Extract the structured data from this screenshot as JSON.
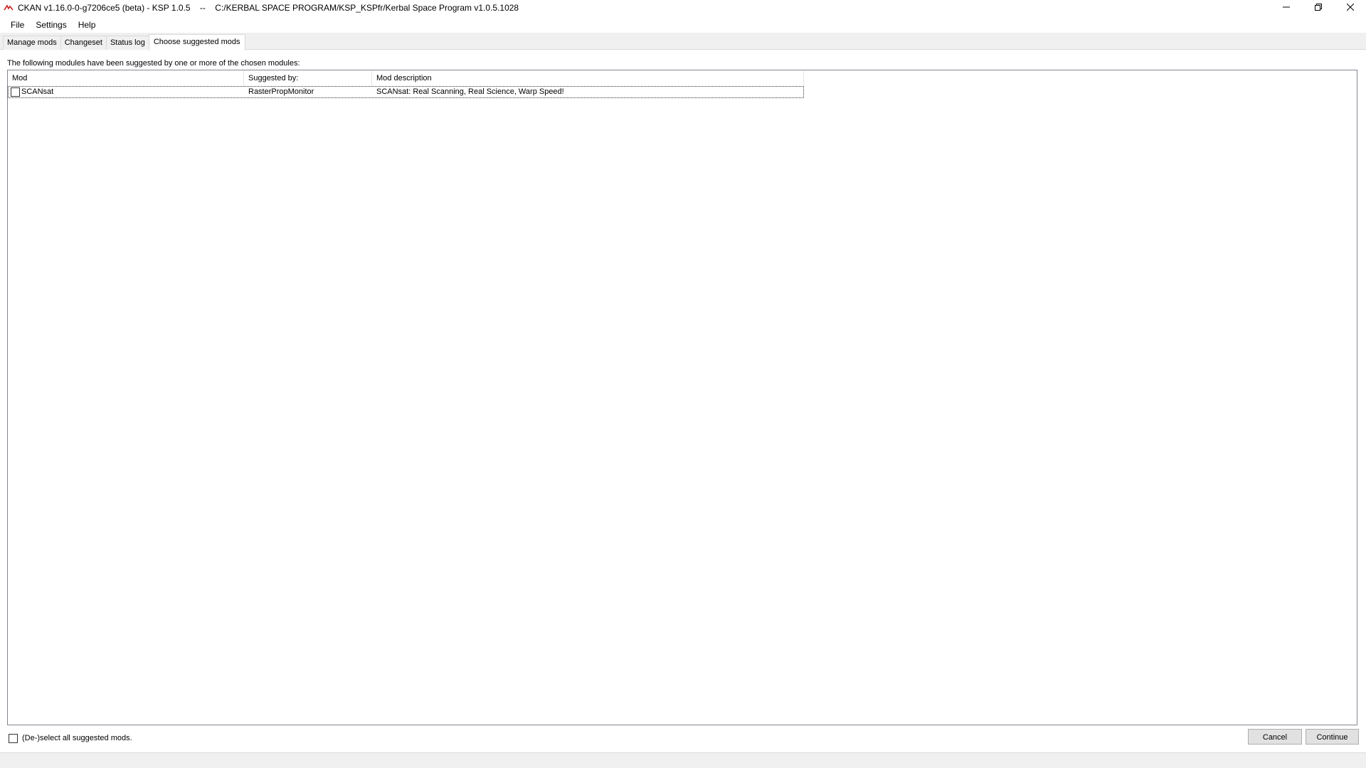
{
  "window": {
    "title": "CKAN v1.16.0-0-g7206ce5 (beta) - KSP 1.0.5    --    C:/KERBAL SPACE PROGRAM/KSP_KSPfr/Kerbal Space Program v1.0.5.1028",
    "icons": {
      "app": "ckan-logo-icon",
      "minimize": "minimize-icon",
      "restore": "restore-icon",
      "close": "close-icon"
    },
    "colors": {
      "app_icon": "#d02020"
    }
  },
  "menu": {
    "items": [
      "File",
      "Settings",
      "Help"
    ]
  },
  "tabs": [
    {
      "label": "Manage mods",
      "active": false
    },
    {
      "label": "Changeset",
      "active": false
    },
    {
      "label": "Status log",
      "active": false
    },
    {
      "label": "Choose suggested mods",
      "active": true
    }
  ],
  "suggestions": {
    "intro": "The following modules have been suggested by one or more of the chosen modules:",
    "columns": [
      "Mod",
      "Suggested by:",
      "Mod description"
    ],
    "rows": [
      {
        "checked": false,
        "mod": "SCANsat",
        "suggested_by": "RasterPropMonitor",
        "description": "SCANsat: Real Scanning, Real Science, Warp Speed!"
      }
    ],
    "select_all_label": "(De-)select all suggested mods.",
    "select_all_checked": false
  },
  "buttons": {
    "cancel": "Cancel",
    "continue": "Continue"
  }
}
